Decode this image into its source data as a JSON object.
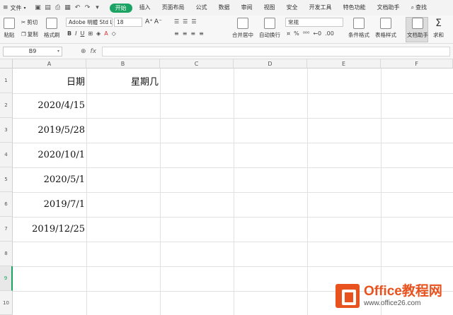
{
  "menu": {
    "file_label": "文件",
    "tabs": [
      "开始",
      "插入",
      "页面布局",
      "公式",
      "数据",
      "审阅",
      "视图",
      "安全",
      "开发工具",
      "特色功能",
      "文档助手"
    ],
    "active_tab": "开始",
    "search_label": "查找"
  },
  "ribbon": {
    "paste_label": "粘贴",
    "cut_label": "剪切",
    "copy_label": "复制",
    "format_painter_label": "格式刷",
    "font_name": "Adobe 明體 Std L",
    "font_size": "18",
    "merge_label": "合并居中",
    "wrap_label": "自动换行",
    "number_format": "常规",
    "cond_format_label": "条件格式",
    "table_style_label": "表格样式",
    "doc_helper_label": "文档助手",
    "sum_label": "求和"
  },
  "formula_bar": {
    "cell_ref": "B9",
    "fx_label": "fx",
    "value": ""
  },
  "sheet": {
    "columns": [
      "A",
      "B",
      "C",
      "D",
      "E",
      "F"
    ],
    "rows": [
      "1",
      "2",
      "3",
      "4",
      "5",
      "6",
      "7",
      "8",
      "9",
      "10"
    ],
    "selected_row": "9",
    "header_a": "日期",
    "header_b": "星期几",
    "dates": [
      "2020/4/15",
      "2019/5/28",
      "2020/10/1",
      "2020/5/1",
      "2019/7/1",
      "2019/12/25"
    ]
  },
  "watermark": {
    "title": "Office教程网",
    "url": "www.office26.com"
  }
}
